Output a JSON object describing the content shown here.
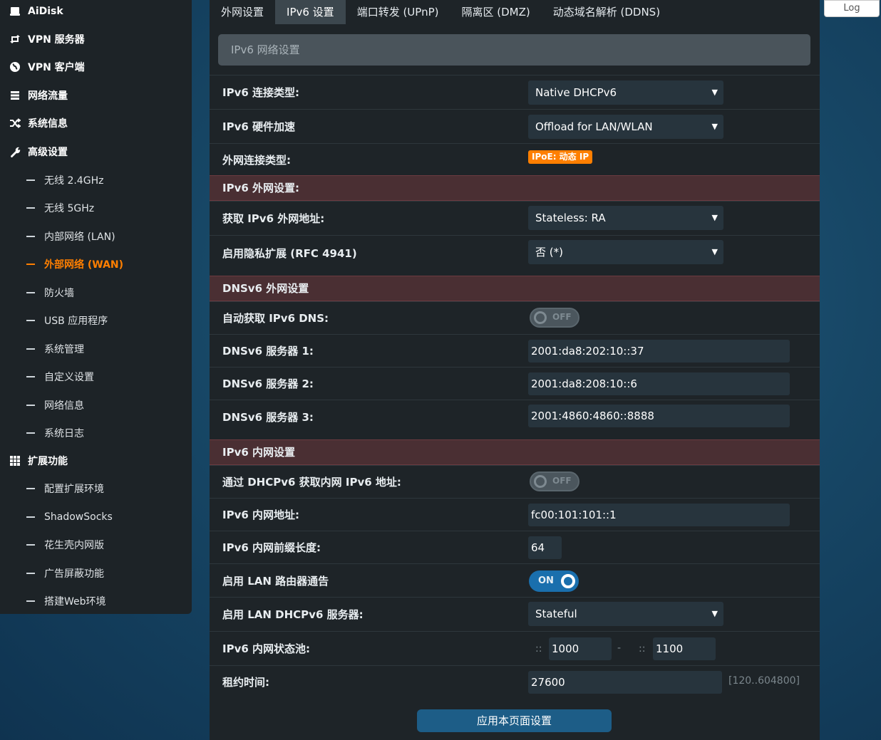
{
  "sidebar": {
    "items": [
      {
        "label": "AiDisk",
        "icon": "disk-icon"
      },
      {
        "label": "VPN 服务器",
        "icon": "vpn-server-icon"
      },
      {
        "label": "VPN 客户端",
        "icon": "globe-icon"
      },
      {
        "label": "网络流量",
        "icon": "traffic-icon"
      },
      {
        "label": "系统信息",
        "icon": "shuffle-icon"
      },
      {
        "label": "高级设置",
        "icon": "wrench-icon"
      }
    ],
    "advanced_sub": [
      "无线 2.4GHz",
      "无线 5GHz",
      "内部网络 (LAN)",
      "外部网络 (WAN)",
      "防火墙",
      "USB 应用程序",
      "系统管理",
      "自定义设置",
      "网络信息",
      "系统日志"
    ],
    "extensions": {
      "label": "扩展功能",
      "icon": "grid-icon"
    },
    "extension_sub": [
      "配置扩展环境",
      "ShadowSocks",
      "花生壳内网版",
      "广告屏蔽功能",
      "搭建Web环境"
    ]
  },
  "tabs": [
    "外网设置",
    "IPv6 设置",
    "端口转发 (UPnP)",
    "隔离区 (DMZ)",
    "动态域名解析 (DDNS)"
  ],
  "title": "IPv6 网络设置",
  "fields": {
    "conn_type": {
      "label": "IPv6 连接类型:",
      "value": "Native DHCPv6"
    },
    "hw_accel": {
      "label": "IPv6 硬件加速",
      "value": "Offload for LAN/WLAN"
    },
    "wan_type": {
      "label": "外网连接类型:",
      "value": "IPoE: 动态 IP"
    }
  },
  "sections": {
    "wan": "IPv6 外网设置:",
    "dns": "DNSv6 外网设置",
    "lan": "IPv6 内网设置"
  },
  "wan": {
    "get_addr": {
      "label": "获取 IPv6 外网地址:",
      "value": "Stateless: RA"
    },
    "privacy": {
      "label": "启用隐私扩展 (RFC 4941)",
      "value": "否 (*)"
    }
  },
  "dns": {
    "auto": {
      "label": "自动获取 IPv6 DNS:",
      "state": "OFF"
    },
    "server1": {
      "label": "DNSv6 服务器 1:",
      "value": "2001:da8:202:10::37"
    },
    "server2": {
      "label": "DNSv6 服务器 2:",
      "value": "2001:da8:208:10::6"
    },
    "server3": {
      "label": "DNSv6 服务器 3:",
      "value": "2001:4860:4860::8888"
    }
  },
  "lan": {
    "dhcp_addr": {
      "label": "通过 DHCPv6 获取内网 IPv6 地址:",
      "state": "OFF"
    },
    "addr": {
      "label": "IPv6 内网地址:",
      "value": "fc00:101:101::1"
    },
    "prefix": {
      "label": "IPv6 内网前缀长度:",
      "value": "64"
    },
    "router_adv": {
      "label": "启用 LAN 路由器通告",
      "state": "ON"
    },
    "dhcp_server": {
      "label": "启用 LAN DHCPv6 服务器:",
      "value": "Stateful"
    },
    "pool": {
      "label": "IPv6 内网状态池:",
      "start": "1000",
      "end": "1100",
      "sep": "::",
      "dash": "-"
    },
    "lease": {
      "label": "租约时间:",
      "value": "27600",
      "hint": "[120..604800]"
    }
  },
  "apply_label": "应用本页面设置",
  "log_label": "Log",
  "colors": {
    "accent": "#ff7f00",
    "active_blue": "#1a6fad",
    "section_bg": "#4a2f33"
  }
}
